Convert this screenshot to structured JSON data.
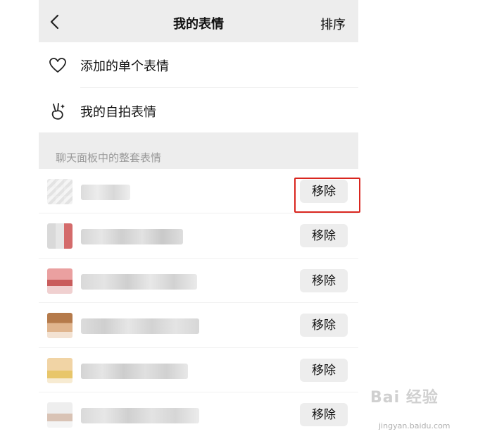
{
  "header": {
    "title": "我的表情",
    "sort_label": "排序"
  },
  "menu": {
    "items": [
      {
        "label": "添加的单个表情",
        "icon": "heart-icon"
      },
      {
        "label": "我的自拍表情",
        "icon": "victory-hand-icon"
      }
    ]
  },
  "section": {
    "title": "聊天面板中的整套表情"
  },
  "packs": [
    {
      "name": "",
      "action_label": "移除"
    },
    {
      "name": "",
      "action_label": "移除"
    },
    {
      "name": "",
      "action_label": "移除"
    },
    {
      "name": "",
      "action_label": "移除"
    },
    {
      "name": "",
      "action_label": "移除"
    },
    {
      "name": "",
      "action_label": "移除"
    }
  ],
  "colors": {
    "highlight": "#d9261f",
    "header_bg": "#ededed",
    "button_bg": "#ededed"
  },
  "watermark": {
    "brand": "Bai 经验",
    "url": "jingyan.baidu.com"
  }
}
